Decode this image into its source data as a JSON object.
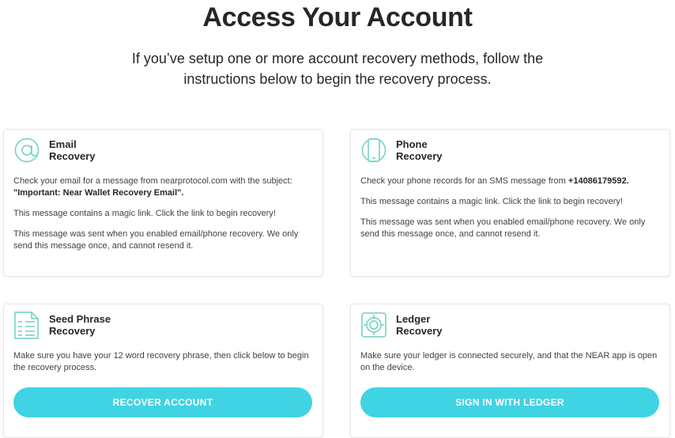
{
  "header": {
    "title": "Access Your Account",
    "subtitle": "If you’ve setup one or more account recovery methods, follow the instructions below to begin the recovery process."
  },
  "cards": {
    "email": {
      "icon": "at-sign-icon",
      "title": "Email",
      "subtitle": "Recovery",
      "line1_prefix": "Check your email for a message from nearprotocol.com with the subject: ",
      "line1_bold": "\"Important: Near Wallet Recovery Email\".",
      "line2": "This message contains a magic link. Click the link to begin recovery!",
      "line3": "This message was sent when you enabled email/phone recovery. We only send this message once, and cannot resend it."
    },
    "phone": {
      "icon": "phone-icon",
      "title": "Phone",
      "subtitle": "Recovery",
      "line1_prefix": "Check your phone records for an SMS message from ",
      "line1_bold": "+14086179592.",
      "line2": "This message contains a magic link. Click the link to begin recovery!",
      "line3": "This message was sent when you enabled email/phone recovery. We only send this message once, and cannot resend it."
    },
    "seed": {
      "icon": "seed-phrase-list-icon",
      "title": "Seed Phrase",
      "subtitle": "Recovery",
      "line1": "Make sure you have your 12 word recovery phrase, then click below to begin the recovery process.",
      "button_label": "RECOVER ACCOUNT"
    },
    "ledger": {
      "icon": "ledger-device-icon",
      "title": "Ledger",
      "subtitle": "Recovery",
      "line1": "Make sure your ledger is connected securely, and that the NEAR app is open on the device.",
      "button_label": "SIGN IN WITH LEDGER"
    }
  },
  "colors": {
    "accent": "#40d3e3",
    "icon": "#6ad1c0",
    "heading": "#25272a",
    "body_text": "#3f4246"
  }
}
